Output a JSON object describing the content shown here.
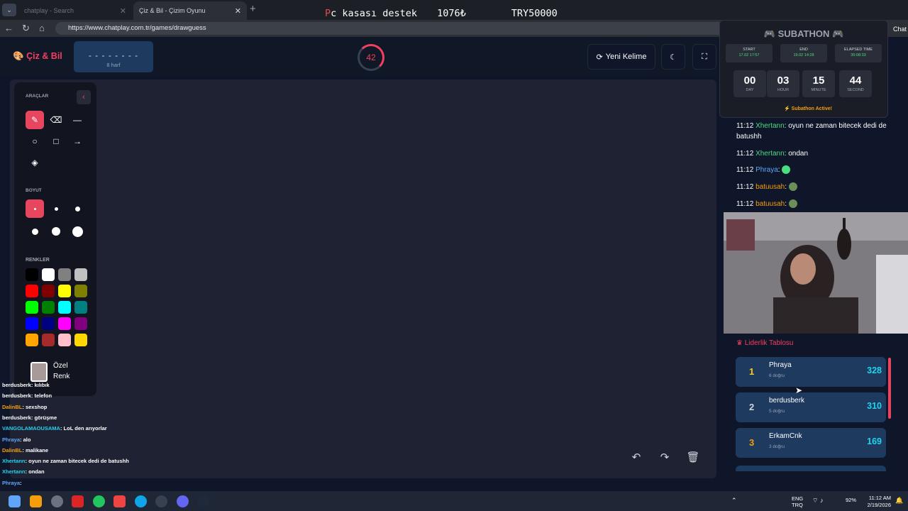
{
  "browser": {
    "tabs": [
      {
        "label": "chatplay - Search"
      },
      {
        "label": "Çiz & Bil - Çizim Oyunu"
      }
    ],
    "url": "https://www.chatplay.com.tr/games/drawguess",
    "chat_label": "Chat"
  },
  "ticker": {
    "prefix": "P",
    "text": "c kasası destek",
    "amount": "1076₺",
    "goal": "TRY50000"
  },
  "game": {
    "logo": "Çiz & Bil",
    "word_mask": "- - - - - - - -",
    "word_len": "8 harf",
    "timer": "42",
    "new_word_label": "Yeni Kelime",
    "tools_title": "ARAÇLAR",
    "size_title": "BOYUT",
    "colors_title": "RENKLER",
    "custom_color": "Özel Renk",
    "palette": [
      "#000000",
      "#ffffff",
      "#808080",
      "#c0c0c0",
      "#ff0000",
      "#800000",
      "#ffff00",
      "#808000",
      "#00ff00",
      "#008000",
      "#00ffff",
      "#008080",
      "#0000ff",
      "#000080",
      "#ff00ff",
      "#800080",
      "#ffa500",
      "#a52a2a",
      "#ffc0cb",
      "#ffd700"
    ]
  },
  "overlay_chat": [
    {
      "user": "berdusberk",
      "msg": "kılıbık",
      "color": "#fff"
    },
    {
      "user": "berdusberk",
      "msg": "telefon",
      "color": "#fff"
    },
    {
      "user": "DalinBL",
      "msg": "sexshop",
      "color": "#f59e0b"
    },
    {
      "user": "berdusberk",
      "msg": "görüşme",
      "color": "#fff"
    },
    {
      "user": "VANGOLAMAOUSAMA",
      "msg": "LoL den arıyorlar",
      "color": "#22d3ee"
    },
    {
      "user": "Phraya",
      "msg": "alo",
      "color": "#60a5fa"
    },
    {
      "user": "DalinBL",
      "msg": "malikane",
      "color": "#f59e0b"
    },
    {
      "user": "Xhertann",
      "msg": "oyun ne zaman bitecek dedi de batushh",
      "color": "#22d3ee"
    },
    {
      "user": "Xhertann",
      "msg": "ondan",
      "color": "#22d3ee"
    },
    {
      "user": "Phraya",
      "msg": "",
      "color": "#60a5fa"
    },
    {
      "user": "batuusah",
      "msg": "",
      "color": "#f59e0b"
    },
    {
      "user": "batuusah",
      "msg": "",
      "color": "#f59e0b"
    }
  ],
  "subathon": {
    "title": "SUBATHON",
    "start_label": "START",
    "start_val": "17.02 17:57",
    "end_label": "END",
    "end_val": "19.02 14:28",
    "elapsed_label": "ELAPSED TIME",
    "elapsed_val": "35:08:33",
    "days": "00",
    "days_l": "DAY",
    "hours": "03",
    "hours_l": "HOUR",
    "minutes": "15",
    "minutes_l": "MINUTE",
    "seconds": "44",
    "seconds_l": "SECOND",
    "status": "Subathon Active!"
  },
  "right_chat": [
    {
      "time": "11:12",
      "user": "Xhertann",
      "msg": "oyun ne zaman bitecek dedi de batushh",
      "color": "#4ade80"
    },
    {
      "time": "11:12",
      "user": "Xhertann",
      "msg": "ondan",
      "color": "#4ade80"
    },
    {
      "time": "11:12",
      "user": "Phraya",
      "msg": "",
      "color": "#60a5fa"
    },
    {
      "time": "11:12",
      "user": "batuusah",
      "msg": "",
      "color": "#f59e0b"
    },
    {
      "time": "11:12",
      "user": "batuusah",
      "msg": "",
      "color": "#f59e0b"
    }
  ],
  "leaderboard": {
    "title": "Liderlik Tablosu",
    "rows": [
      {
        "rank": "1",
        "name": "Phraya",
        "sub": "6 doğru",
        "score": "328",
        "rank_color": "#facc15"
      },
      {
        "rank": "2",
        "name": "berdusberk",
        "sub": "5 doğru",
        "score": "310",
        "rank_color": "#cbd5e1"
      },
      {
        "rank": "3",
        "name": "ErkamCnk",
        "sub": "3 doğru",
        "score": "169",
        "rank_color": "#f59e0b"
      }
    ]
  },
  "taskbar": {
    "lang1": "ENG",
    "lang2": "TRQ",
    "battery": "92%",
    "time": "11:12 AM",
    "date": "2/19/2026"
  }
}
